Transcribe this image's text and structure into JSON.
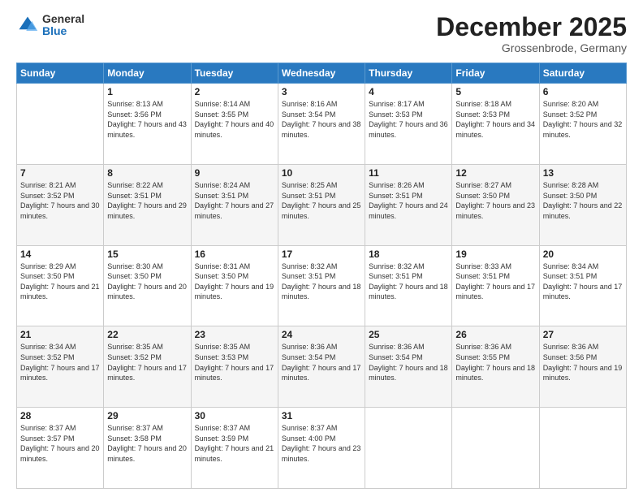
{
  "logo": {
    "general": "General",
    "blue": "Blue"
  },
  "header": {
    "month": "December 2025",
    "location": "Grossenbrode, Germany"
  },
  "weekdays": [
    "Sunday",
    "Monday",
    "Tuesday",
    "Wednesday",
    "Thursday",
    "Friday",
    "Saturday"
  ],
  "weeks": [
    [
      {
        "day": "",
        "sunrise": "",
        "sunset": "",
        "daylight": ""
      },
      {
        "day": "1",
        "sunrise": "Sunrise: 8:13 AM",
        "sunset": "Sunset: 3:56 PM",
        "daylight": "Daylight: 7 hours and 43 minutes."
      },
      {
        "day": "2",
        "sunrise": "Sunrise: 8:14 AM",
        "sunset": "Sunset: 3:55 PM",
        "daylight": "Daylight: 7 hours and 40 minutes."
      },
      {
        "day": "3",
        "sunrise": "Sunrise: 8:16 AM",
        "sunset": "Sunset: 3:54 PM",
        "daylight": "Daylight: 7 hours and 38 minutes."
      },
      {
        "day": "4",
        "sunrise": "Sunrise: 8:17 AM",
        "sunset": "Sunset: 3:53 PM",
        "daylight": "Daylight: 7 hours and 36 minutes."
      },
      {
        "day": "5",
        "sunrise": "Sunrise: 8:18 AM",
        "sunset": "Sunset: 3:53 PM",
        "daylight": "Daylight: 7 hours and 34 minutes."
      },
      {
        "day": "6",
        "sunrise": "Sunrise: 8:20 AM",
        "sunset": "Sunset: 3:52 PM",
        "daylight": "Daylight: 7 hours and 32 minutes."
      }
    ],
    [
      {
        "day": "7",
        "sunrise": "Sunrise: 8:21 AM",
        "sunset": "Sunset: 3:52 PM",
        "daylight": "Daylight: 7 hours and 30 minutes."
      },
      {
        "day": "8",
        "sunrise": "Sunrise: 8:22 AM",
        "sunset": "Sunset: 3:51 PM",
        "daylight": "Daylight: 7 hours and 29 minutes."
      },
      {
        "day": "9",
        "sunrise": "Sunrise: 8:24 AM",
        "sunset": "Sunset: 3:51 PM",
        "daylight": "Daylight: 7 hours and 27 minutes."
      },
      {
        "day": "10",
        "sunrise": "Sunrise: 8:25 AM",
        "sunset": "Sunset: 3:51 PM",
        "daylight": "Daylight: 7 hours and 25 minutes."
      },
      {
        "day": "11",
        "sunrise": "Sunrise: 8:26 AM",
        "sunset": "Sunset: 3:51 PM",
        "daylight": "Daylight: 7 hours and 24 minutes."
      },
      {
        "day": "12",
        "sunrise": "Sunrise: 8:27 AM",
        "sunset": "Sunset: 3:50 PM",
        "daylight": "Daylight: 7 hours and 23 minutes."
      },
      {
        "day": "13",
        "sunrise": "Sunrise: 8:28 AM",
        "sunset": "Sunset: 3:50 PM",
        "daylight": "Daylight: 7 hours and 22 minutes."
      }
    ],
    [
      {
        "day": "14",
        "sunrise": "Sunrise: 8:29 AM",
        "sunset": "Sunset: 3:50 PM",
        "daylight": "Daylight: 7 hours and 21 minutes."
      },
      {
        "day": "15",
        "sunrise": "Sunrise: 8:30 AM",
        "sunset": "Sunset: 3:50 PM",
        "daylight": "Daylight: 7 hours and 20 minutes."
      },
      {
        "day": "16",
        "sunrise": "Sunrise: 8:31 AM",
        "sunset": "Sunset: 3:50 PM",
        "daylight": "Daylight: 7 hours and 19 minutes."
      },
      {
        "day": "17",
        "sunrise": "Sunrise: 8:32 AM",
        "sunset": "Sunset: 3:51 PM",
        "daylight": "Daylight: 7 hours and 18 minutes."
      },
      {
        "day": "18",
        "sunrise": "Sunrise: 8:32 AM",
        "sunset": "Sunset: 3:51 PM",
        "daylight": "Daylight: 7 hours and 18 minutes."
      },
      {
        "day": "19",
        "sunrise": "Sunrise: 8:33 AM",
        "sunset": "Sunset: 3:51 PM",
        "daylight": "Daylight: 7 hours and 17 minutes."
      },
      {
        "day": "20",
        "sunrise": "Sunrise: 8:34 AM",
        "sunset": "Sunset: 3:51 PM",
        "daylight": "Daylight: 7 hours and 17 minutes."
      }
    ],
    [
      {
        "day": "21",
        "sunrise": "Sunrise: 8:34 AM",
        "sunset": "Sunset: 3:52 PM",
        "daylight": "Daylight: 7 hours and 17 minutes."
      },
      {
        "day": "22",
        "sunrise": "Sunrise: 8:35 AM",
        "sunset": "Sunset: 3:52 PM",
        "daylight": "Daylight: 7 hours and 17 minutes."
      },
      {
        "day": "23",
        "sunrise": "Sunrise: 8:35 AM",
        "sunset": "Sunset: 3:53 PM",
        "daylight": "Daylight: 7 hours and 17 minutes."
      },
      {
        "day": "24",
        "sunrise": "Sunrise: 8:36 AM",
        "sunset": "Sunset: 3:54 PM",
        "daylight": "Daylight: 7 hours and 17 minutes."
      },
      {
        "day": "25",
        "sunrise": "Sunrise: 8:36 AM",
        "sunset": "Sunset: 3:54 PM",
        "daylight": "Daylight: 7 hours and 18 minutes."
      },
      {
        "day": "26",
        "sunrise": "Sunrise: 8:36 AM",
        "sunset": "Sunset: 3:55 PM",
        "daylight": "Daylight: 7 hours and 18 minutes."
      },
      {
        "day": "27",
        "sunrise": "Sunrise: 8:36 AM",
        "sunset": "Sunset: 3:56 PM",
        "daylight": "Daylight: 7 hours and 19 minutes."
      }
    ],
    [
      {
        "day": "28",
        "sunrise": "Sunrise: 8:37 AM",
        "sunset": "Sunset: 3:57 PM",
        "daylight": "Daylight: 7 hours and 20 minutes."
      },
      {
        "day": "29",
        "sunrise": "Sunrise: 8:37 AM",
        "sunset": "Sunset: 3:58 PM",
        "daylight": "Daylight: 7 hours and 20 minutes."
      },
      {
        "day": "30",
        "sunrise": "Sunrise: 8:37 AM",
        "sunset": "Sunset: 3:59 PM",
        "daylight": "Daylight: 7 hours and 21 minutes."
      },
      {
        "day": "31",
        "sunrise": "Sunrise: 8:37 AM",
        "sunset": "Sunset: 4:00 PM",
        "daylight": "Daylight: 7 hours and 23 minutes."
      },
      {
        "day": "",
        "sunrise": "",
        "sunset": "",
        "daylight": ""
      },
      {
        "day": "",
        "sunrise": "",
        "sunset": "",
        "daylight": ""
      },
      {
        "day": "",
        "sunrise": "",
        "sunset": "",
        "daylight": ""
      }
    ]
  ]
}
